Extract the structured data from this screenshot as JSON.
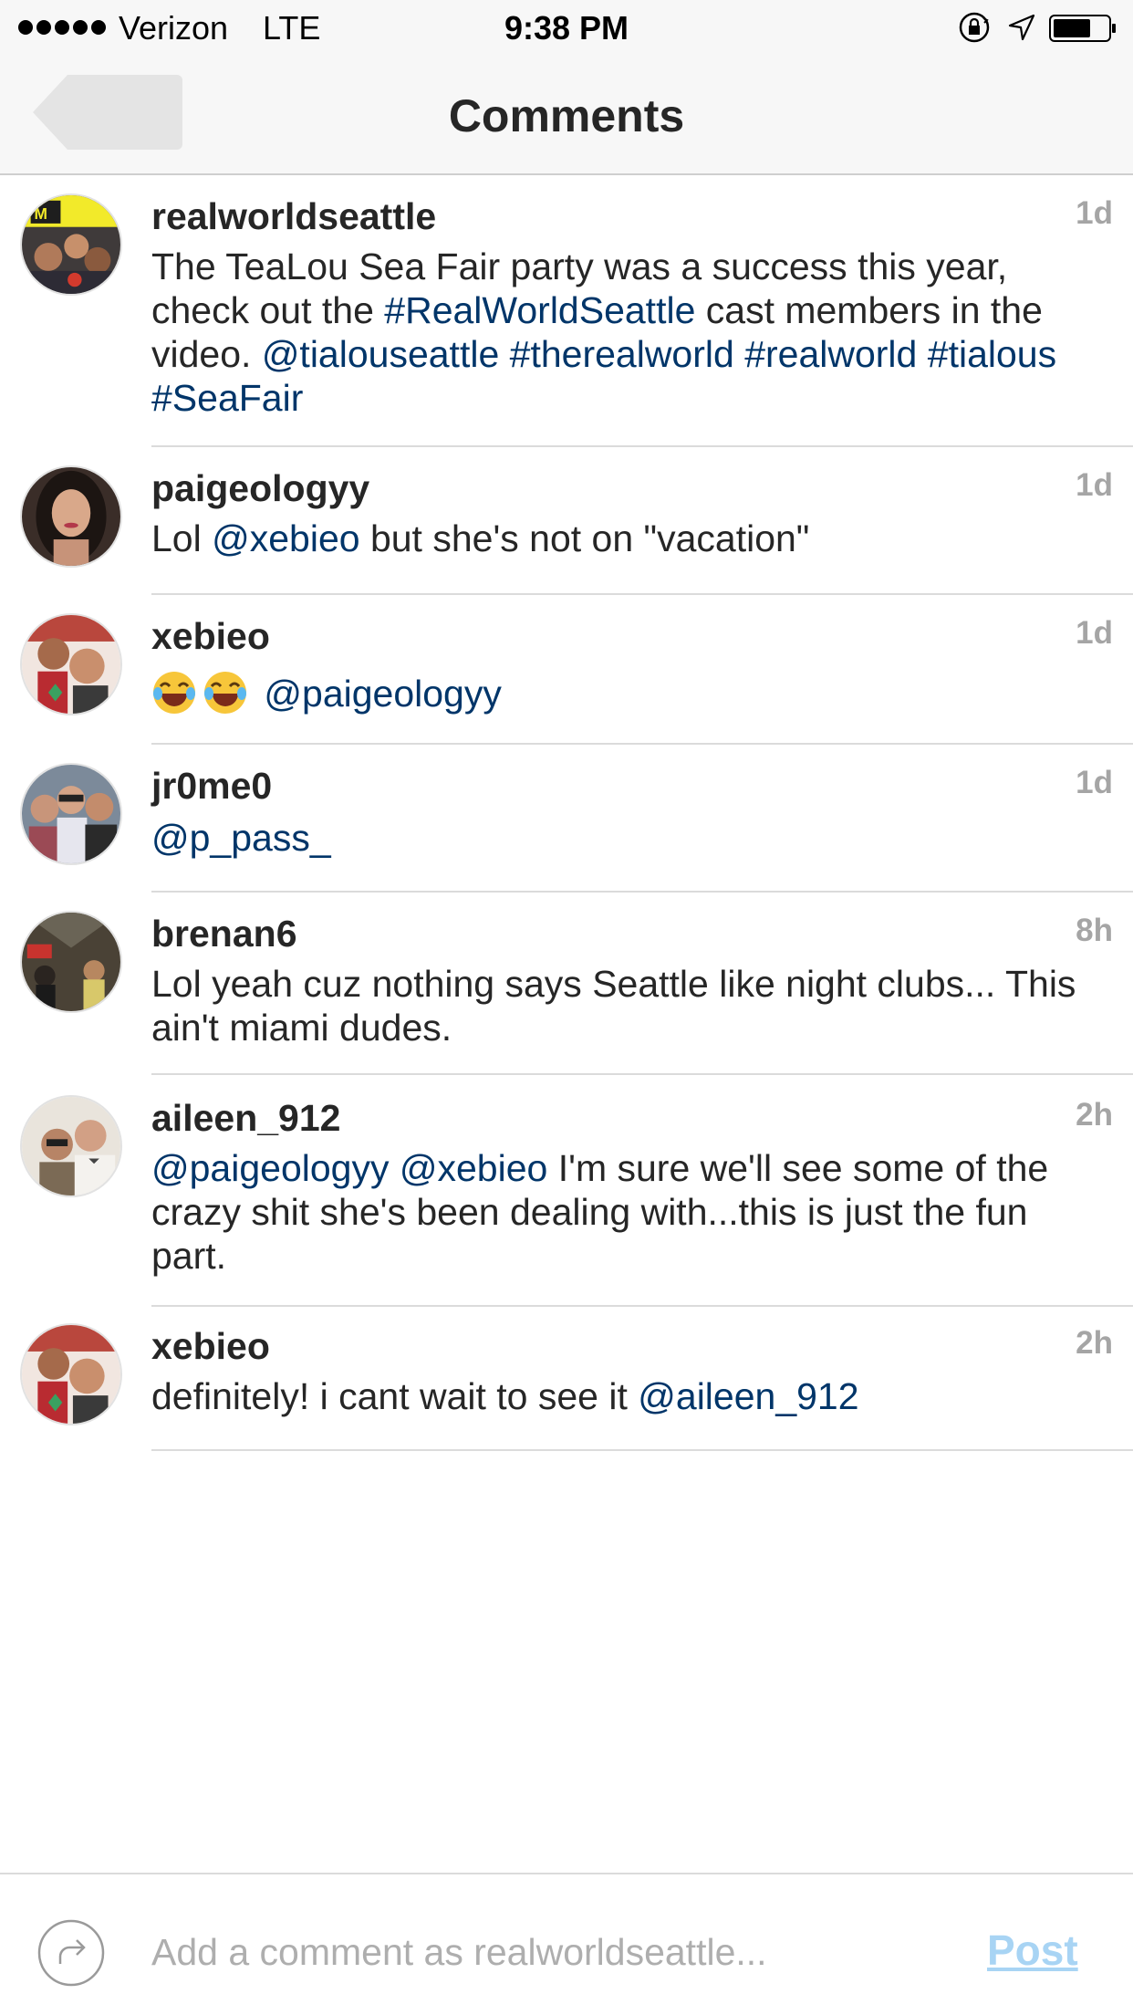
{
  "status_bar": {
    "carrier": "Verizon",
    "network": "LTE",
    "time": "9:38 PM"
  },
  "nav": {
    "title": "Comments"
  },
  "comments": [
    {
      "username": "realworldseattle",
      "time": "1d",
      "text_parts": [
        {
          "t": "The TeaLou Sea Fair party was a success this year, check out the "
        },
        {
          "t": "#RealWorldSeattle",
          "tag": true
        },
        {
          "t": " cast members in the video. "
        },
        {
          "t": "@tialouseattle",
          "tag": true
        },
        {
          "t": " "
        },
        {
          "t": "#therealworld",
          "tag": true
        },
        {
          "t": " "
        },
        {
          "t": "#realworld",
          "tag": true
        },
        {
          "t": " "
        },
        {
          "t": "#tialous",
          "tag": true
        },
        {
          "t": " "
        },
        {
          "t": "#SeaFair",
          "tag": true
        }
      ]
    },
    {
      "username": "paigeologyy",
      "time": "1d",
      "text_parts": [
        {
          "t": "Lol "
        },
        {
          "t": "@xebieo",
          "tag": true
        },
        {
          "t": " but she's not on \"vacation\""
        }
      ]
    },
    {
      "username": "xebieo",
      "time": "1d",
      "emoji_count": 2,
      "text_parts": [
        {
          "t": "@paigeologyy",
          "tag": true
        }
      ]
    },
    {
      "username": "jr0me0",
      "time": "1d",
      "text_parts": [
        {
          "t": "@p_pass_",
          "tag": true
        }
      ]
    },
    {
      "username": "brenan6",
      "time": "8h",
      "text_parts": [
        {
          "t": "Lol yeah cuz nothing says Seattle like night clubs... This ain't miami dudes."
        }
      ]
    },
    {
      "username": "aileen_912",
      "time": "2h",
      "text_parts": [
        {
          "t": "@paigeologyy",
          "tag": true
        },
        {
          "t": " "
        },
        {
          "t": "@xebieo",
          "tag": true
        },
        {
          "t": " I'm sure we'll see some of the crazy shit she's been dealing with...this is just the fun part."
        }
      ]
    },
    {
      "username": "xebieo",
      "time": "2h",
      "text_parts": [
        {
          "t": "definitely! i cant wait to see it "
        },
        {
          "t": "@aileen_912",
          "tag": true
        }
      ]
    }
  ],
  "composer": {
    "placeholder": "Add a comment as realworldseattle...",
    "post_label": "Post"
  },
  "colors": {
    "tag": "#003569",
    "post_disabled": "#a8d4f4",
    "time_ago": "#a5a5a5"
  }
}
